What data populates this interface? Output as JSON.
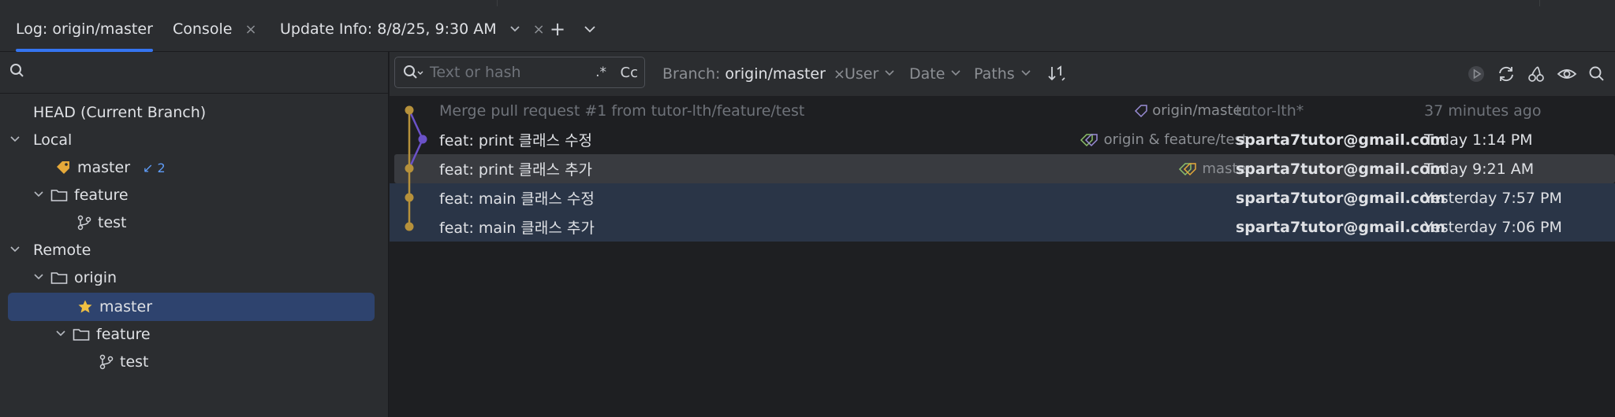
{
  "tabs": [
    {
      "label": "Log: origin/master"
    },
    {
      "label": "Console"
    },
    {
      "label": "Update Info: 8/8/25, 9:30 AM"
    }
  ],
  "icons": {
    "close": "×",
    "chevron": "⌄",
    "plus": "+"
  },
  "tree": {
    "head": "HEAD (Current Branch)",
    "local": "Local",
    "local_master": "master",
    "local_master_badge": "↙ 2",
    "local_feature": "feature",
    "local_test": "test",
    "remote": "Remote",
    "origin": "origin",
    "origin_master": "master",
    "origin_feature": "feature",
    "origin_test": "test"
  },
  "toolbar": {
    "search_placeholder": "Text or hash",
    "regex_label": ".*",
    "case_label": "Cc",
    "branch_label": "Branch:",
    "branch_value": "origin/master",
    "user_label": "User",
    "date_label": "Date",
    "paths_label": "Paths"
  },
  "commits": [
    {
      "message": "Merge pull request #1 from tutor-lth/feature/test",
      "refs": "origin/master",
      "author": "tutor-lth*",
      "date": "37 minutes ago"
    },
    {
      "message": "feat: print 클래스 수정",
      "refs": "origin & feature/test",
      "author": "sparta7tutor@gmail.com",
      "date": "Today 1:14 PM"
    },
    {
      "message": "feat: print 클래스 추가",
      "refs": "master",
      "author": "sparta7tutor@gmail.com",
      "date": "Today 9:21 AM"
    },
    {
      "message": "feat: main 클래스 수정",
      "refs": "",
      "author": "sparta7tutor@gmail.com",
      "date": "Yesterday 7:57 PM"
    },
    {
      "message": "feat: main 클래스 추가",
      "refs": "",
      "author": "sparta7tutor@gmail.com",
      "date": "Yesterday 7:06 PM"
    }
  ],
  "colors": {
    "accent": "#3574f0",
    "graph_gold": "#b6913b",
    "graph_purple": "#6b52c8",
    "selection": "#2e436e"
  }
}
